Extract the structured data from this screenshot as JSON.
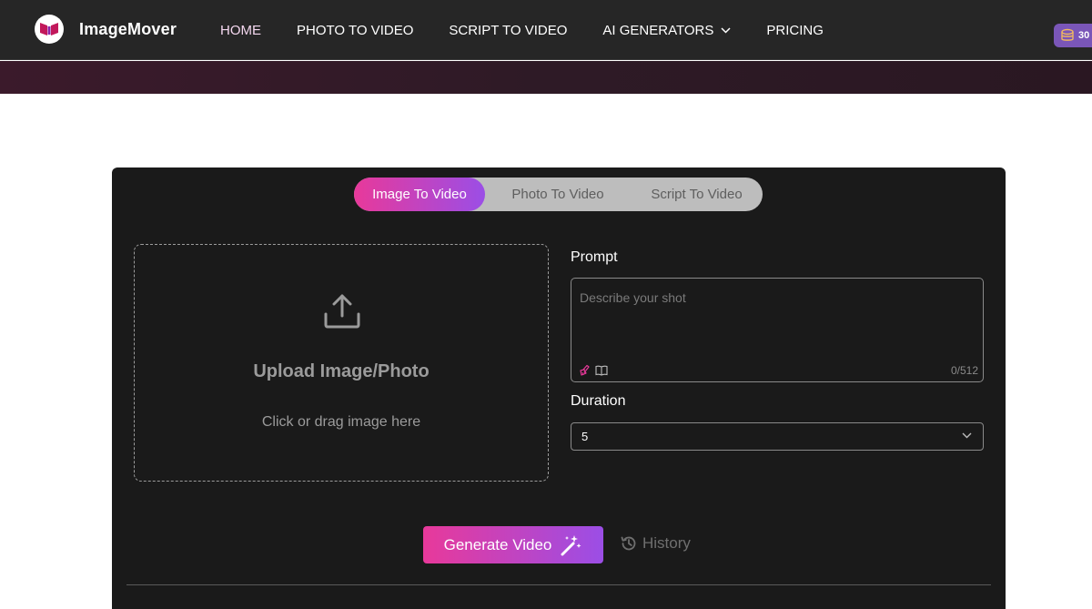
{
  "header": {
    "brand": "ImageMover",
    "nav": [
      {
        "label": "HOME",
        "active": true
      },
      {
        "label": "PHOTO TO VIDEO"
      },
      {
        "label": "SCRIPT TO VIDEO"
      },
      {
        "label": "AI GENERATORS",
        "dropdown": true
      },
      {
        "label": "PRICING"
      }
    ],
    "credits": "30"
  },
  "tabs": [
    "Image To Video",
    "Photo To Video",
    "Script To Video"
  ],
  "upload": {
    "title": "Upload Image/Photo",
    "subtitle": "Click or drag image here"
  },
  "prompt": {
    "label": "Prompt",
    "placeholder": "Describe your shot",
    "counter": "0/512"
  },
  "duration": {
    "label": "Duration",
    "value": "5"
  },
  "actions": {
    "generate_label": "Generate Video",
    "history_label": "History"
  },
  "colors": {
    "accent_start": "#e8399a",
    "accent_end": "#9b4ee6",
    "card_bg": "#1a1a1a",
    "header_bg": "#262626"
  }
}
